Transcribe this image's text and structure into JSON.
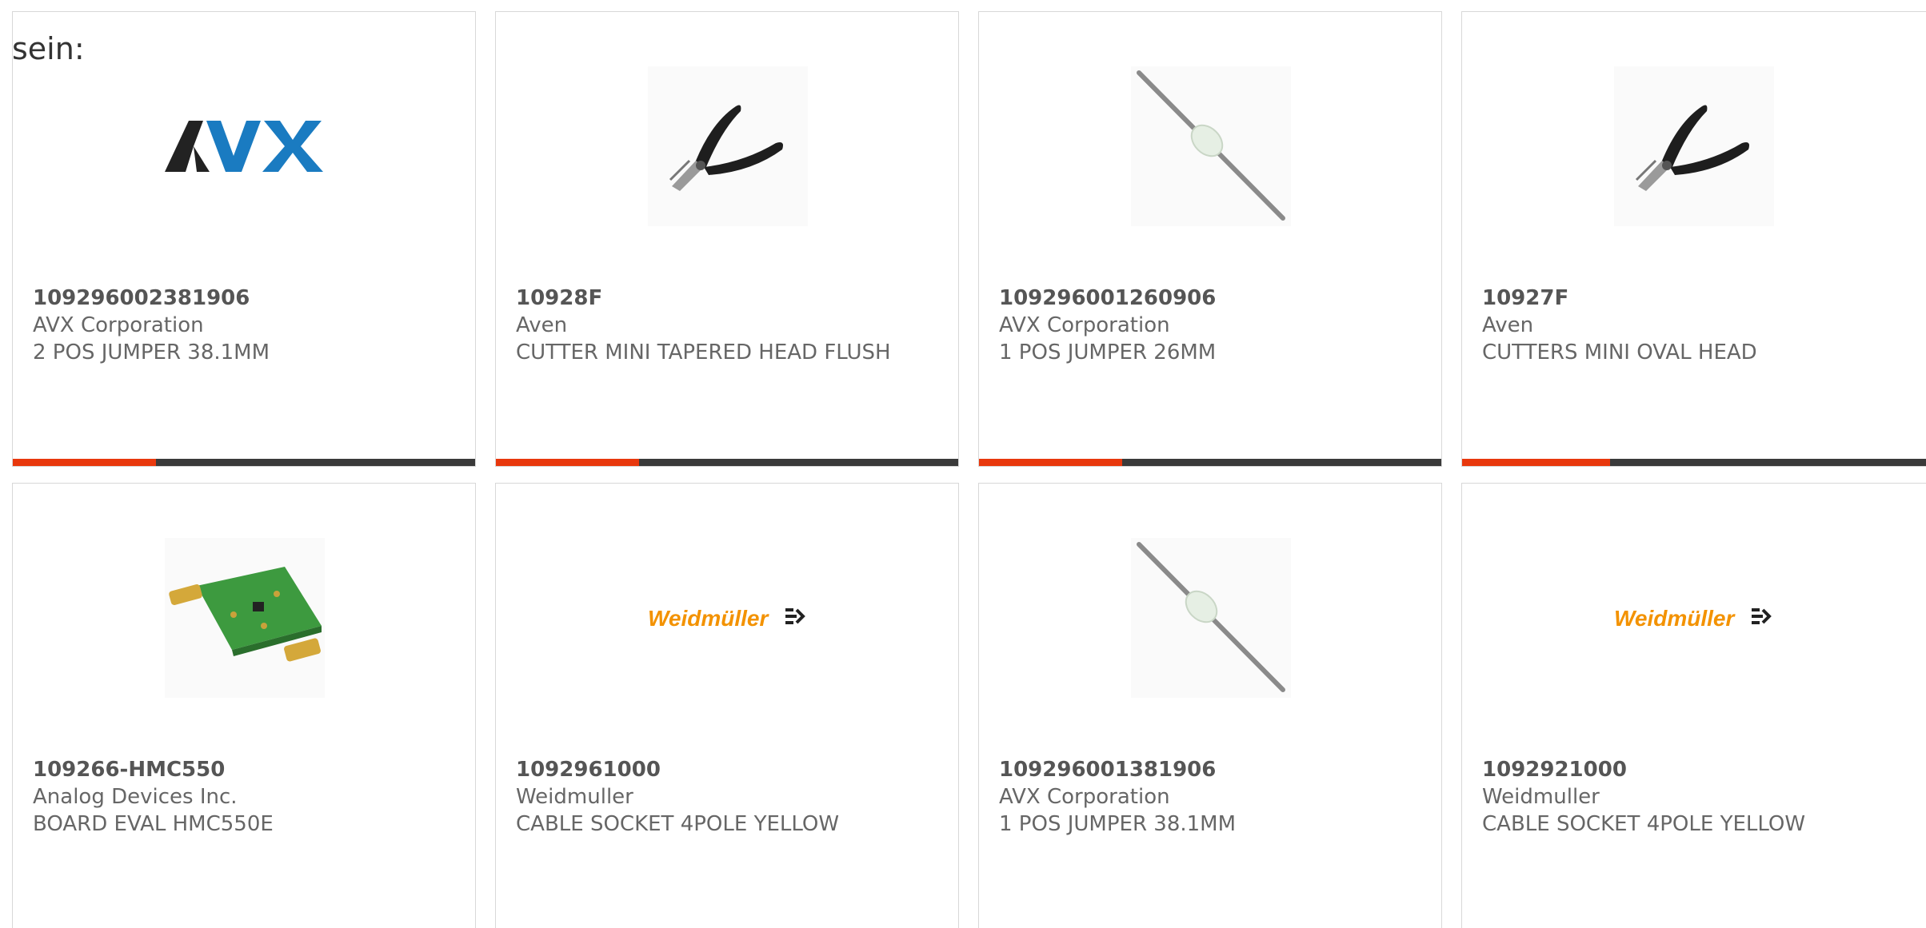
{
  "intro_text": "sein:",
  "colors": {
    "bar_accent": "#e8380d",
    "bar_track": "#3a3a3a",
    "card_border": "#d8d8d8",
    "avx_blue": "#1a7bc1",
    "weidmuller_orange": "#f39200"
  },
  "cards": [
    {
      "part_number": "109296002381906",
      "manufacturer": "AVX Corporation",
      "description": "2 POS JUMPER 38.1MM",
      "image": "avx-logo",
      "logo_text": "AVX",
      "bar_fraction": 0.31
    },
    {
      "part_number": "10928F",
      "manufacturer": "Aven",
      "description": "CUTTER MINI TAPERED HEAD FLUSH",
      "image": "cutter-icon",
      "bar_fraction": 0.31
    },
    {
      "part_number": "109296001260906",
      "manufacturer": "AVX Corporation",
      "description": "1 POS JUMPER 26MM",
      "image": "jumper-icon",
      "bar_fraction": 0.31
    },
    {
      "part_number": "10927F",
      "manufacturer": "Aven",
      "description": "CUTTERS MINI OVAL HEAD",
      "image": "cutter-icon",
      "bar_fraction": 0.31
    },
    {
      "part_number": "109266-HMC550",
      "manufacturer": "Analog Devices Inc.",
      "description": "BOARD EVAL HMC550E",
      "image": "eval-board-icon"
    },
    {
      "part_number": "1092961000",
      "manufacturer": "Weidmuller",
      "description": "CABLE SOCKET 4POLE YELLOW",
      "image": "weidmuller-logo",
      "logo_text": "Weidmüller"
    },
    {
      "part_number": "109296001381906",
      "manufacturer": "AVX Corporation",
      "description": "1 POS JUMPER 38.1MM",
      "image": "jumper-icon"
    },
    {
      "part_number": "1092921000",
      "manufacturer": "Weidmuller",
      "description": "CABLE SOCKET 4POLE YELLOW",
      "image": "weidmuller-logo",
      "logo_text": "Weidmüller"
    }
  ]
}
